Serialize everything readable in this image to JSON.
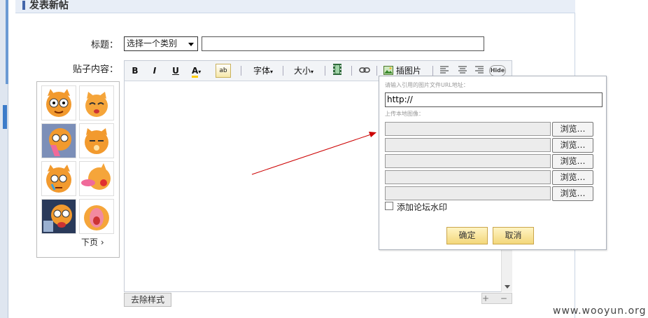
{
  "header": {
    "title": "发表新帖"
  },
  "form": {
    "subject_label": "标题：",
    "category_selected": "选择一个类别",
    "content_label": "贴子内容："
  },
  "toolbar": {
    "bold": "B",
    "italic": "I",
    "underline": "U",
    "font_color": "A",
    "font_label": "字体",
    "size_label": "大小",
    "insert_image_label": "插图片",
    "hide_label": "Hide"
  },
  "smilies": {
    "next_page": "下页 ›"
  },
  "editor": {
    "remove_style": "去除样式",
    "resize": "+ −"
  },
  "image_popup": {
    "url_hint": "请输入引用的图片文件URL地址：",
    "url_value": "http://",
    "upload_hint": "上传本地图像：",
    "browse_labels": [
      "浏览…",
      "浏览…",
      "浏览…",
      "浏览…",
      "浏览…"
    ],
    "watermark_label": "添加论坛水印",
    "confirm": "确定",
    "cancel": "取消"
  },
  "watermark": "www.wooyun.org",
  "colors": {
    "accent": "#4466aa",
    "confirm_bg": "#f3d77a",
    "annotation_arrow": "#cc0000"
  }
}
